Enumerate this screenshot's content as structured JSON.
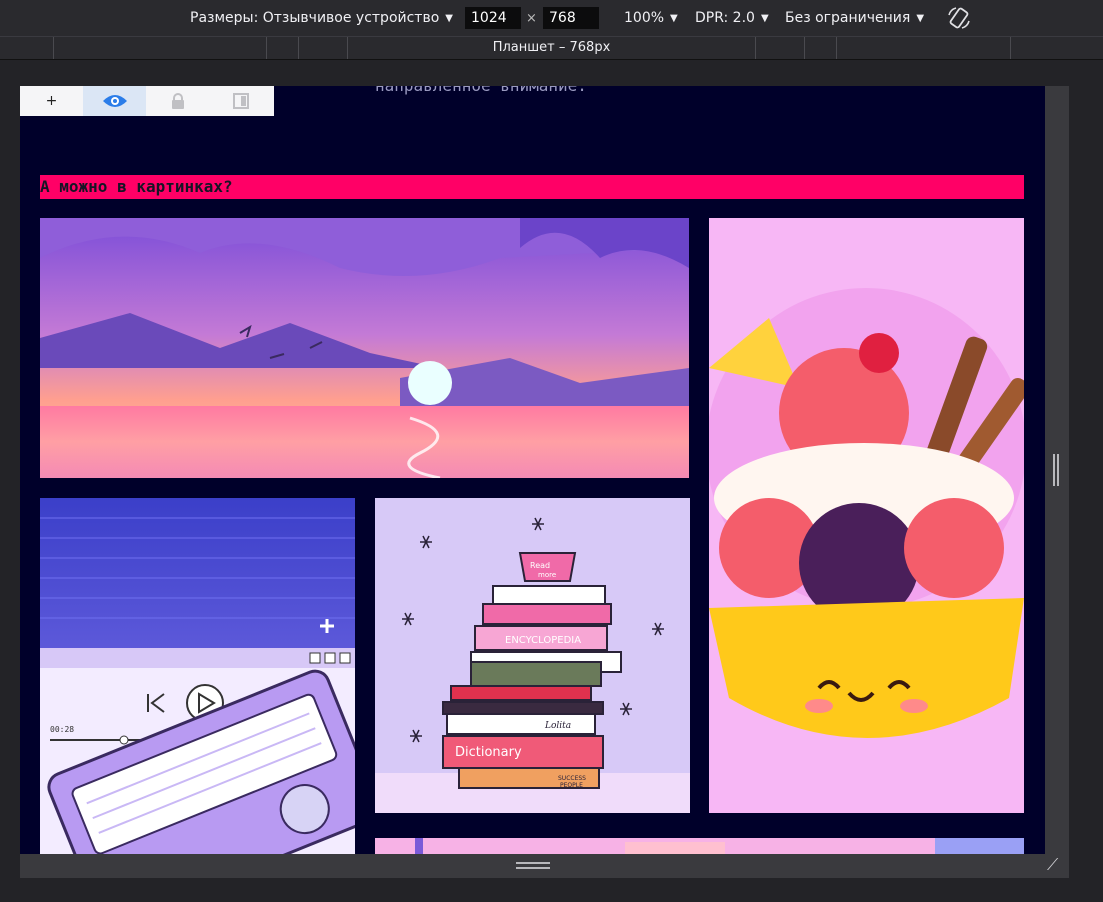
{
  "toolbar": {
    "device_label": "Размеры: Отзывчивое устройство",
    "width_value": "1024",
    "times_symbol": "×",
    "height_value": "768",
    "zoom": "100%",
    "dpr": "DPR: 2.0",
    "throttling": "Без ограничения",
    "rotate_icon": "rotate-device-icon"
  },
  "ruler": {
    "label": "Планшет – 768px"
  },
  "image_toolbar": {
    "add_label": "+",
    "icons": [
      "eye-icon",
      "lock-icon",
      "contrast-icon"
    ]
  },
  "page": {
    "previous_text": "направленное внимание.",
    "heading": "А можно в картинках?"
  },
  "images": {
    "sunset": "sunset-illustration",
    "retro": "retro-cassette-player-illustration",
    "books": "book-stack-illustration",
    "icecream": "ice-cream-sundae-illustration",
    "player_time": "00:28",
    "book_labels": [
      "Read more",
      "ENCYCLOPEDIA",
      "Lolita",
      "Dictionary",
      "SUCCESS PEOPLE"
    ]
  },
  "colors": {
    "accent": "#ff0066",
    "page_bg": "#00002a",
    "toolbar_bg": "#2a2a2e"
  }
}
